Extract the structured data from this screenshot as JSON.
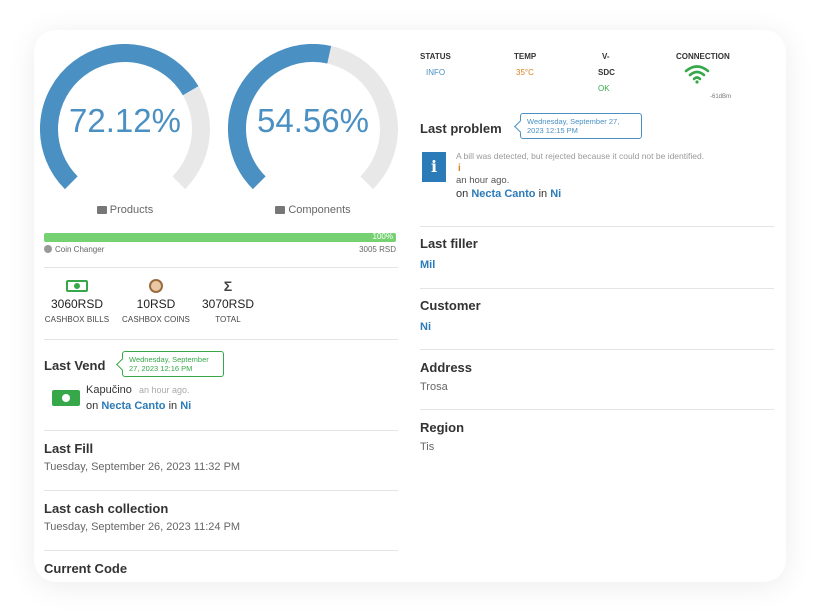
{
  "gauges": {
    "products": {
      "value": "72.12%",
      "fraction": 0.7212,
      "label": "Products"
    },
    "components": {
      "value": "54.56%",
      "fraction": 0.5456,
      "label": "Components"
    }
  },
  "coin_changer": {
    "percent": "100%",
    "fraction": 1.0,
    "label": "Coin Changer",
    "amount": "3005 RSD"
  },
  "cashbox": {
    "bills": {
      "amount": "3060RSD",
      "label": "CASHBOX BILLS"
    },
    "coins": {
      "amount": "10RSD",
      "label": "CASHBOX COINS"
    },
    "total": {
      "amount": "3070RSD",
      "label": "TOTAL",
      "symbol": "Σ"
    }
  },
  "last_vend": {
    "title": "Last Vend",
    "tooltip": "Wednesday, September 27, 2023 12:16 PM",
    "product": "Kapučino",
    "time": "an hour ago.",
    "on": "on",
    "location": "Necta Canto",
    "in": "in",
    "place": "Ni"
  },
  "last_fill": {
    "title": "Last Fill",
    "value": "Tuesday, September 26, 2023 11:32 PM"
  },
  "last_cash": {
    "title": "Last cash collection",
    "value": "Tuesday, September 26, 2023 11:24 PM"
  },
  "current_code": {
    "title": "Current Code"
  },
  "status": {
    "status_head": "STATUS",
    "status_val": "INFO",
    "temp_head": "TEMP",
    "temp_val": "35°C",
    "v_head": "V-",
    "v_head2": "SDC",
    "v_val": "OK",
    "conn_head": "CONNECTION",
    "conn_val": "-61dBm"
  },
  "last_problem": {
    "title": "Last problem",
    "tooltip": "Wednesday, September 27, 2023 12:15 PM",
    "message": "A bill was detected, but rejected because it could not be identified.",
    "warn": "i",
    "time": "an hour ago.",
    "on": "on",
    "location": "Necta Canto",
    "in": "in",
    "place": "Ni"
  },
  "last_filler": {
    "title": "Last filler",
    "value": "Mil"
  },
  "customer": {
    "title": "Customer",
    "value": "Ni"
  },
  "address": {
    "title": "Address",
    "value": "Trosa"
  },
  "region": {
    "title": "Region",
    "value": "Tis"
  },
  "colors": {
    "accent": "#4a90c2",
    "green": "#37a84a",
    "bar": "#76d172",
    "track": "#e8e8e8",
    "orange": "#d98020",
    "link": "#2b7bb9"
  }
}
